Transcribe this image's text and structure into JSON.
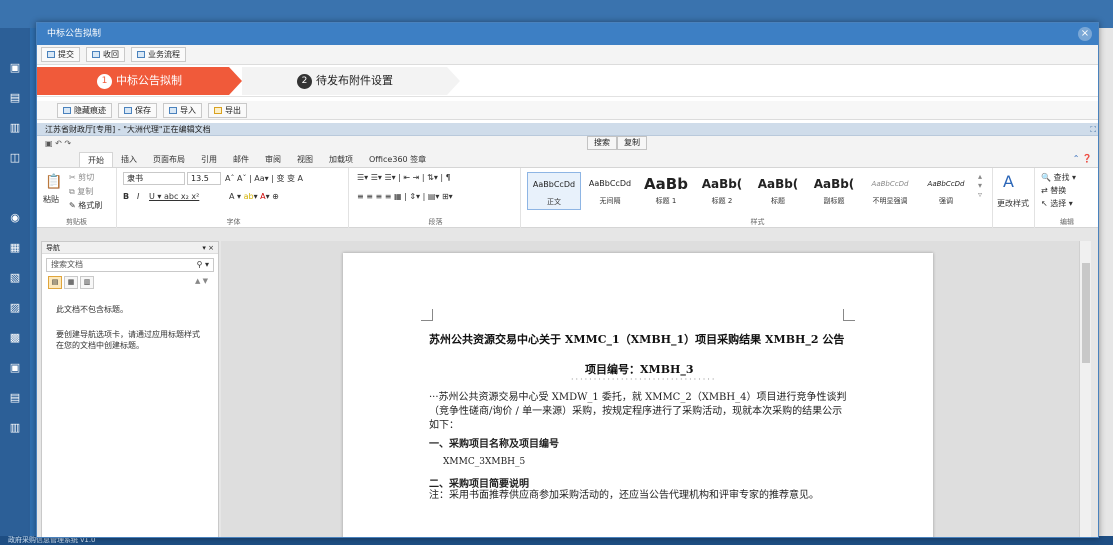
{
  "dialog": {
    "title": "中标公告拟制",
    "close": "×",
    "toolbar": [
      {
        "label": "提交"
      },
      {
        "label": "收回"
      },
      {
        "label": "业务流程"
      }
    ]
  },
  "steps": [
    {
      "num": "1",
      "label": "中标公告拟制"
    },
    {
      "num": "2",
      "label": "待发布附件设置"
    }
  ],
  "toolbar2": [
    {
      "label": "隐藏痕迹"
    },
    {
      "label": "保存"
    },
    {
      "label": "导入"
    },
    {
      "label": "导出"
    }
  ],
  "word": {
    "title": "江苏省财政厅[专用] - \"大洲代理\"正在编辑文档",
    "search_btn": "搜索",
    "copy_btn": "复制",
    "tabs": [
      "开始",
      "插入",
      "页面布局",
      "引用",
      "邮件",
      "审阅",
      "视图",
      "加载项",
      "Office360 签章"
    ],
    "clipboard": {
      "cut": "剪切",
      "copy": "复制",
      "paste": "粘贴",
      "format": "格式刷",
      "label": "剪贴板"
    },
    "font": {
      "name": "隶书",
      "size": "13.5",
      "label": "字体"
    },
    "para_label": "段落",
    "styles": [
      {
        "sample": "AaBbCcDd",
        "name": "正文"
      },
      {
        "sample": "AaBbCcDd",
        "name": "无间隔"
      },
      {
        "sample": "AaBb",
        "name": "标题 1"
      },
      {
        "sample": "AaBb(",
        "name": "标题 2"
      },
      {
        "sample": "AaBb(",
        "name": "标题"
      },
      {
        "sample": "AaBb(",
        "name": "副标题"
      },
      {
        "sample": "AaBbCcDd",
        "name": "不明显强调"
      },
      {
        "sample": "AaBbCcDd",
        "name": "强调"
      }
    ],
    "styles_label": "样式",
    "change_style": "更改样式",
    "edit": {
      "find": "查找",
      "replace": "替换",
      "select": "选择",
      "label": "编辑"
    }
  },
  "nav": {
    "title": "导航",
    "search_placeholder": "搜索文档",
    "msg1": "此文档不包含标题。",
    "msg2": "要创建导航选项卡，请通过应用标题样式在您的文档中创建标题。"
  },
  "doc": {
    "title": "苏州公共资源交易中心关于 XMMC_1（XMBH_1）项目采购结果 XMBH_2 公告",
    "code": "项目编号：XMBH_3",
    "para": "···苏州公共资源交易中心受 XMDW_1 委托，就 XMMC_2（XMBH_4）项目进行竞争性谈判（竞争性磋商/询价 / 单一来源）采购，按规定程序进行了采购活动，现就本次采购的结果公示如下：",
    "h1": "一、采购项目名称及项目编号",
    "val1": "XMMC_3XMBH_5",
    "h2": "二、采购项目简要说明",
    "note": "注：采用书面推荐供应商参加采购活动的，还应当公告代理机构和评审专家的推荐意见。"
  },
  "status": "政府采购信息管理系统 v1.0"
}
